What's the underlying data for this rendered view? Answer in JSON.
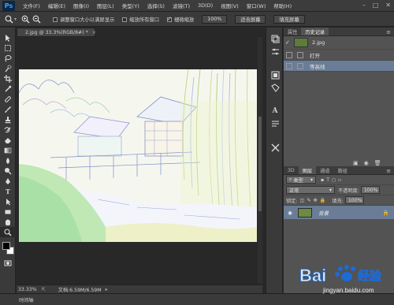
{
  "app": {
    "logo": "Ps",
    "menus": [
      "文件(F)",
      "编辑(E)",
      "图像(I)",
      "图层(L)",
      "类型(Y)",
      "选择(S)",
      "滤镜(T)",
      "3D(D)",
      "视图(V)",
      "窗口(W)",
      "帮助(H)"
    ],
    "window_controls": [
      "–",
      "□",
      "✕"
    ]
  },
  "options_bar": {
    "cb_resize_label": "调整窗口大小以满屏显示",
    "cb_zoom_all_label": "缩放所有窗口",
    "cb_scrubby_label": "细微缩放",
    "btn_100": "100%",
    "btn_fit": "适合屏幕",
    "btn_fill": "填充屏幕",
    "cb_resize_checked": false,
    "cb_zoom_all_checked": false,
    "cb_scrubby_checked": true
  },
  "document": {
    "tab_title": "2.jpg @ 33.3%(RGB/8#) *",
    "tab_close": "×"
  },
  "status": {
    "zoom": "33.33%",
    "doc_size": "文档:6.59M/6.59M",
    "timeline_label": "时间轴"
  },
  "history_panel": {
    "tabs": [
      "属性",
      "历史记录"
    ],
    "active_tab": "历史记录",
    "snapshot_name": "2.jpg",
    "items": [
      {
        "label": "打开"
      },
      {
        "label": "等高线"
      }
    ]
  },
  "layers_panel": {
    "tabs": [
      "3D",
      "图层",
      "通道",
      "路径"
    ],
    "active_tab": "图层",
    "filter_kind": "类型",
    "blend_mode": "正常",
    "opacity_label": "不透明度:",
    "opacity": "100%",
    "lock_label": "锁定:",
    "fill_label": "填充:",
    "fill": "100%",
    "layer_name": "背景"
  },
  "watermark": {
    "text_main": "Bai 经验",
    "text_url": "jingyan.baidu.com"
  },
  "colors": {
    "selection": "#6a7c96",
    "ps_blue": "#33a7ff"
  }
}
